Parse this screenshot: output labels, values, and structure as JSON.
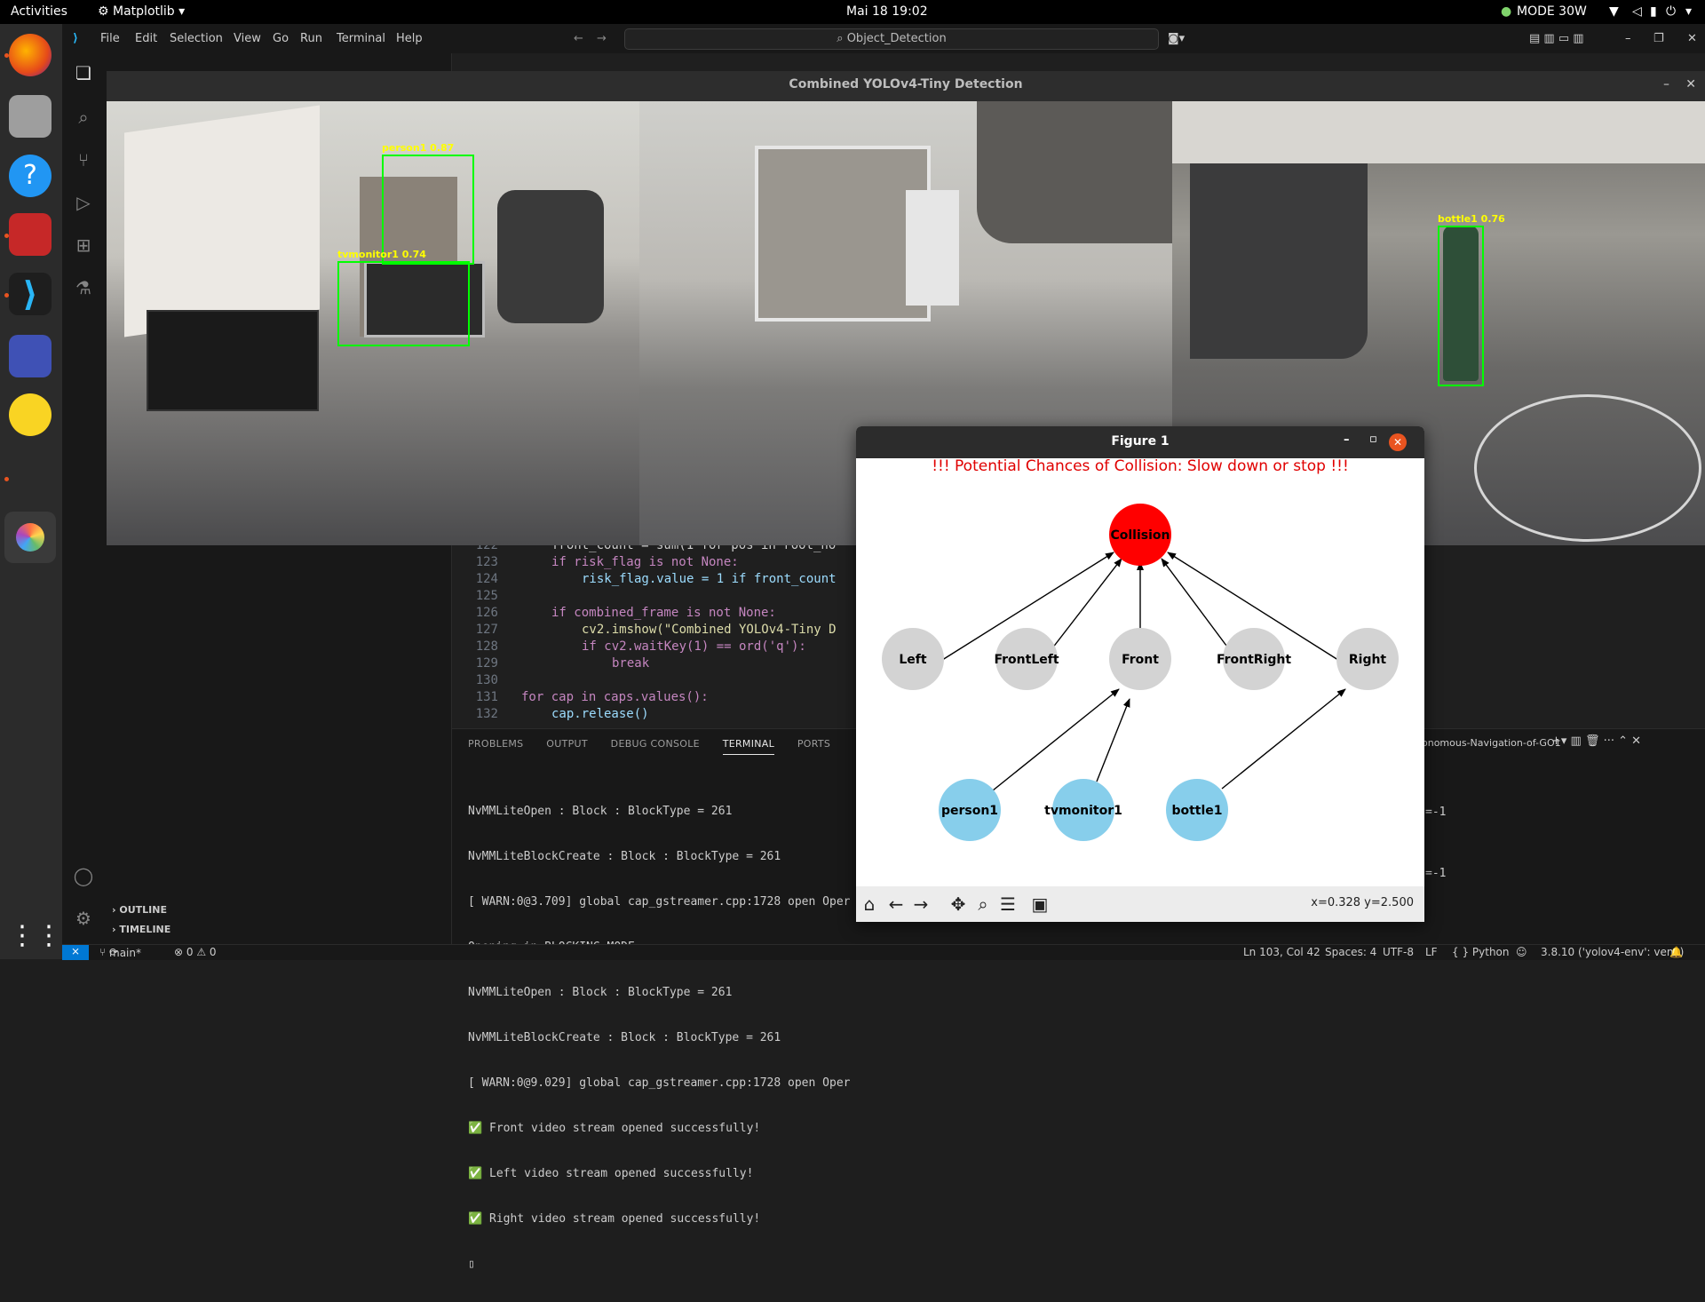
{
  "topbar": {
    "activities": "Activities",
    "app": "Matplotlib",
    "datetime": "Mai 18  19:02",
    "power_mode": "MODE 30W"
  },
  "vscode": {
    "menu": [
      "File",
      "Edit",
      "Selection",
      "View",
      "Go",
      "Run",
      "Terminal",
      "Help"
    ],
    "search": "Object_Detection",
    "sidebar": {
      "outline": "OUTLINE",
      "timeline": "TIMELINE"
    },
    "code": [
      {
        "ln": "122",
        "text": "front_count = sum(1 for pos in root_no"
      },
      {
        "ln": "123",
        "text": "if risk_flag is not None:"
      },
      {
        "ln": "124",
        "text": "risk_flag.value = 1 if front_count"
      },
      {
        "ln": "125",
        "text": ""
      },
      {
        "ln": "126",
        "text": "if combined_frame is not None:"
      },
      {
        "ln": "127",
        "text": "cv2.imshow(\"Combined YOLOv4-Tiny D"
      },
      {
        "ln": "128",
        "text": "if cv2.waitKey(1) == ord('q'):"
      },
      {
        "ln": "129",
        "text": "break"
      },
      {
        "ln": "130",
        "text": ""
      },
      {
        "ln": "131",
        "text": "for cap in caps.values():"
      },
      {
        "ln": "132",
        "text": "cap.release()"
      }
    ],
    "panel_tabs": [
      "PROBLEMS",
      "OUTPUT",
      "DEBUG CONSOLE",
      "TERMINAL",
      "PORTS"
    ],
    "terminal_name": "onomous-Navigation-of-GO1",
    "terminal_lines": [
      "NvMMLiteOpen : Block : BlockType = 261",
      "NvMMLiteBlockCreate : Block : BlockType = 261",
      "[ WARN:0@3.709] global cap_gstreamer.cpp:1728 open Oper",
      "Opening in BLOCKING MODE",
      "NvMMLiteOpen : Block : BlockType = 261",
      "NvMMLiteBlockCreate : Block : BlockType = 261",
      "[ WARN:0@9.029] global cap_gstreamer.cpp:1728 open Oper",
      "✅ Front video stream opened successfully!",
      "✅ Left video stream opened successfully!",
      "✅ Right video stream opened successfully!"
    ],
    "terminal_right": [
      "=-1",
      "=-1"
    ],
    "status": {
      "branch": "main*",
      "problems": "⊗ 0 ⚠ 0",
      "position": "Ln 103, Col 42",
      "spaces": "Spaces: 4",
      "encoding": "UTF-8",
      "eol": "LF",
      "language": "{ } Python",
      "interpreter": "3.8.10 ('yolov4-env': venv)"
    }
  },
  "cv_window": {
    "title": "Combined YOLOv4-Tiny Detection",
    "detections": {
      "person": "person1  0.87",
      "tvmonitor": "tvmonitor1  0.74",
      "bottle": "bottle1  0.76"
    }
  },
  "figure": {
    "window_title": "Figure 1",
    "warning": "!!! Potential Chances of Collision: Slow down or stop !!!",
    "nodes": {
      "collision": "Collision",
      "left": "Left",
      "frontleft": "FrontLeft",
      "front": "Front",
      "frontright": "FrontRight",
      "right": "Right",
      "person": "person1",
      "tvmonitor": "tvmonitor1",
      "bottle": "bottle1"
    },
    "colors": {
      "collision": "#ff0000",
      "zone": "#d3d3d3",
      "object": "#87ceeb"
    },
    "coords": "x=0.328 y=2.500"
  }
}
